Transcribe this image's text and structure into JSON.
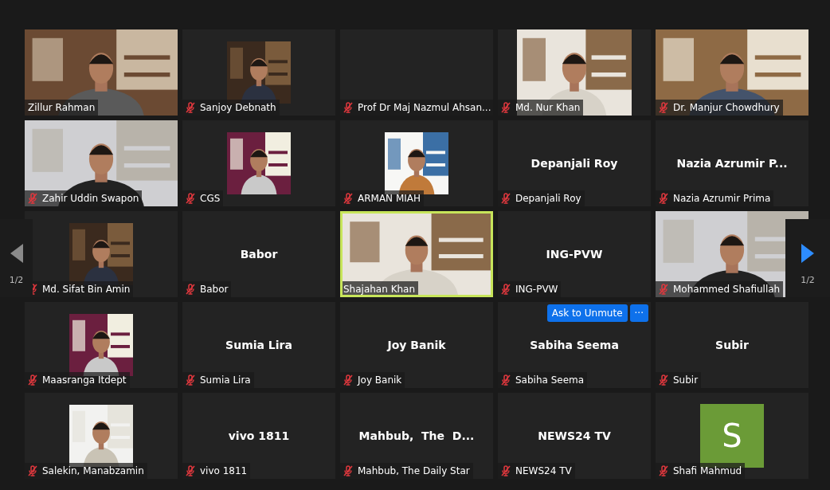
{
  "tiles": [
    {
      "name": "Zillur Rahman",
      "kind": "video",
      "muted": false,
      "speaking": false
    },
    {
      "name": "Sanjoy Debnath",
      "muted": true,
      "speaking": false
    },
    {
      "name": "Prof Dr Maj Nazmul Ahsan...",
      "kind": "blank",
      "muted": true,
      "speaking": false
    },
    {
      "name": "Md. Nur Khan",
      "kind": "pillarbox",
      "muted": true,
      "speaking": false
    },
    {
      "name": "Dr. Manjur Chowdhury",
      "kind": "video",
      "muted": true,
      "speaking": false
    },
    {
      "name": "Zahir Uddin Swapon",
      "kind": "video",
      "muted": true,
      "speaking": false
    },
    {
      "name": "CGS",
      "muted": true,
      "speaking": false
    },
    {
      "name": "ARMAN MIAH",
      "muted": true,
      "speaking": false
    },
    {
      "name": "Depanjali Roy",
      "kind": "name",
      "display_name": "Depanjali Roy",
      "muted": true,
      "speaking": false
    },
    {
      "name": "Nazia Azrumir Prima",
      "kind": "name",
      "display_name": "Nazia Azrumir P...",
      "muted": true,
      "speaking": false
    },
    {
      "name": "Md. Sifat Bin Amin",
      "muted": true,
      "speaking": false
    },
    {
      "name": "Babor",
      "kind": "name",
      "display_name": "Babor",
      "muted": true,
      "speaking": false
    },
    {
      "name": "Shajahan Khan",
      "kind": "video",
      "muted": false,
      "speaking": true
    },
    {
      "name": "ING-PVW",
      "kind": "name",
      "display_name": "ING-PVW",
      "muted": true,
      "speaking": false
    },
    {
      "name": "Mohammed Shafiullah",
      "kind": "video",
      "muted": true,
      "speaking": false
    },
    {
      "name": "Maasranga Itdept",
      "muted": true,
      "speaking": false
    },
    {
      "name": "Sumia Lira",
      "kind": "name",
      "display_name": "Sumia Lira",
      "muted": true,
      "speaking": false
    },
    {
      "name": "Joy Banik",
      "kind": "name",
      "display_name": "Joy Banik",
      "muted": true,
      "speaking": false
    },
    {
      "name": "Sabiha Seema",
      "kind": "name",
      "display_name": "Sabiha Seema",
      "muted": true,
      "speaking": false,
      "hover_buttons": {
        "unmute": "Ask to Unmute",
        "more": "···"
      }
    },
    {
      "name": "Subir",
      "kind": "name",
      "display_name": "Subir",
      "muted": true,
      "speaking": false
    },
    {
      "name": "Salekin, Manabzamin",
      "muted": true,
      "speaking": false
    },
    {
      "name": "vivo 1811",
      "kind": "name",
      "display_name": "vivo 1811",
      "muted": true,
      "speaking": false
    },
    {
      "name": "Mahbub, The Daily Star",
      "kind": "name",
      "display_name": "Mahbub,  The  D...",
      "muted": true,
      "speaking": false
    },
    {
      "name": "NEWS24 TV",
      "kind": "name",
      "display_name": "NEWS24 TV",
      "muted": true,
      "speaking": false
    },
    {
      "name": "Shafi Mahmud",
      "kind": "avatar",
      "initial": "S",
      "muted": true,
      "speaking": false
    }
  ],
  "pager": {
    "previous": {
      "disabled": true,
      "page": "1/2"
    },
    "next": {
      "disabled": false,
      "page": "1/2"
    }
  }
}
